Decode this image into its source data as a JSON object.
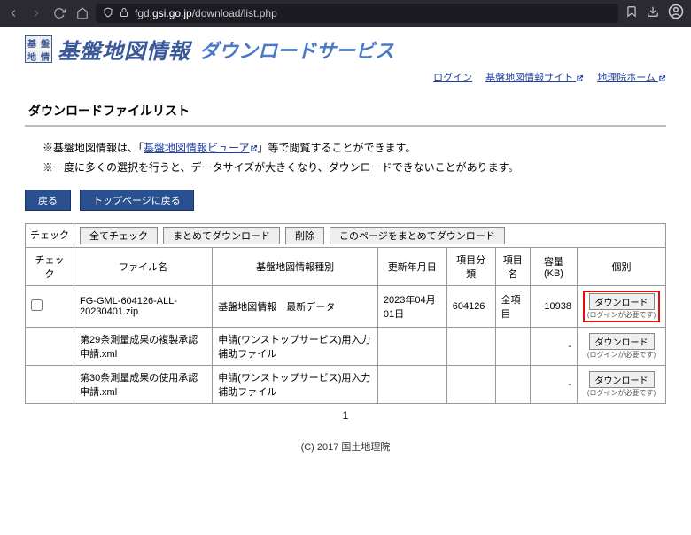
{
  "browser": {
    "url_prefix": "fgd.",
    "url_domain": "gsi.go.jp",
    "url_path": "/download/list.php"
  },
  "banner": {
    "title_main": "基盤地図情報",
    "title_sub": "ダウンロードサービス",
    "logo_chars": [
      "基",
      "盤",
      "地",
      "情"
    ]
  },
  "top_links": {
    "login": "ログイン",
    "site": "基盤地図情報サイト",
    "home": "地理院ホーム"
  },
  "section_title": "ダウンロードファイルリスト",
  "notes": {
    "line1a": "※基盤地図情報は、「",
    "line1_link": "基盤地図情報ビューア",
    "line1b": "」等で閲覧することができます。",
    "line2": "※一度に多くの選択を行うと、データサイズが大きくなり、ダウンロードできないことがあります。"
  },
  "nav_buttons": {
    "back": "戻る",
    "to_top": "トップページに戻る"
  },
  "action_row": {
    "label": "チェック",
    "check_all": "全てチェック",
    "bulk_dl": "まとめてダウンロード",
    "delete": "削除",
    "page_bulk": "このページをまとめてダウンロード"
  },
  "table": {
    "headers": {
      "check": "チェック",
      "filename": "ファイル名",
      "type": "基盤地図情報種別",
      "updated": "更新年月日",
      "category": "項目分類",
      "name": "項目名",
      "size": "容量(KB)",
      "individual": "個別"
    },
    "rows": [
      {
        "checkable": true,
        "filename": "FG-GML-604126-ALL-20230401.zip",
        "type": "基盤地図情報　最新データ",
        "updated": "2023年04月01日",
        "category": "604126",
        "name": "全項目",
        "size": "10938",
        "dl_label": "ダウンロード",
        "dl_note": "(ログインが必要です)",
        "highlight": true
      },
      {
        "checkable": false,
        "filename": "第29条測量成果の複製承認申請.xml",
        "type": "申請(ワンストップサービス)用入力補助ファイル",
        "updated": "",
        "category": "",
        "name": "",
        "size": "-",
        "dl_label": "ダウンロード",
        "dl_note": "(ログインが必要です)",
        "highlight": false
      },
      {
        "checkable": false,
        "filename": "第30条測量成果の使用承認申請.xml",
        "type": "申請(ワンストップサービス)用入力補助ファイル",
        "updated": "",
        "category": "",
        "name": "",
        "size": "-",
        "dl_label": "ダウンロード",
        "dl_note": "(ログインが必要です)",
        "highlight": false
      }
    ]
  },
  "pager": "1",
  "footer": "(C) 2017 国土地理院"
}
